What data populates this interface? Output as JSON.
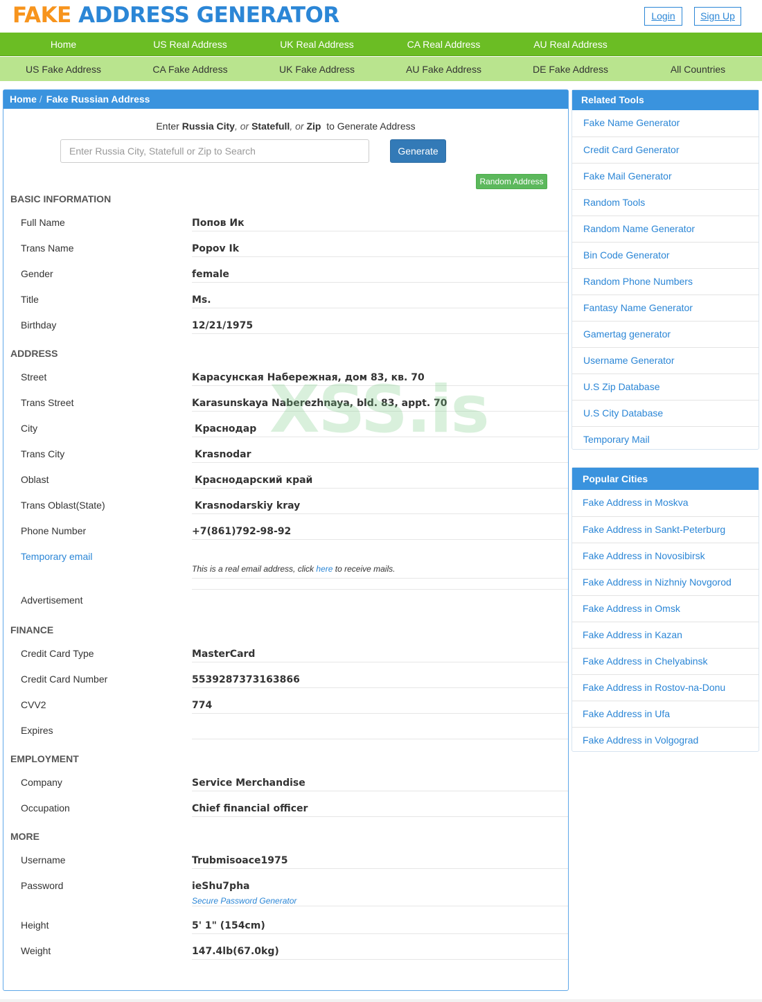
{
  "header": {
    "logo_part1": "FAKE",
    "logo_part2": "ADDRESS GENERATOR",
    "login": "Login",
    "signup": "Sign Up"
  },
  "nav_primary": [
    "Home",
    "US Real Address",
    "UK Real Address",
    "CA Real Address",
    "AU Real Address"
  ],
  "nav_secondary": [
    "US Fake Address",
    "CA Fake Address",
    "UK Fake Address",
    "AU Fake Address",
    "DE Fake Address",
    "All Countries"
  ],
  "breadcrumb": {
    "home": "Home",
    "separator": "/",
    "current": "Fake Russian Address"
  },
  "search": {
    "prefix": "Enter",
    "k1": "Russia City",
    "or1": ", or",
    "k2": "Statefull",
    "or2": ", or",
    "k3": "Zip",
    "suffix": "to Generate Address",
    "placeholder": "Enter Russia City, Statefull or Zip to Search",
    "generate": "Generate",
    "random": "Random Address"
  },
  "watermark": "XSS.is",
  "basic": {
    "title": "BASIC INFORMATION",
    "rows": [
      {
        "label": "Full Name",
        "value": "Попов Ик"
      },
      {
        "label": "Trans Name",
        "value": "Popov Ik"
      },
      {
        "label": "Gender",
        "value": "female"
      },
      {
        "label": "Title",
        "value": "Ms."
      },
      {
        "label": "Birthday",
        "value": "12/21/1975"
      }
    ]
  },
  "address": {
    "title": "ADDRESS",
    "rows": [
      {
        "label": "Street",
        "value": "Карасунская Набережная, дом 83, кв. 70"
      },
      {
        "label": "Trans Street",
        "value": "Karasunskaya Naberezhnaya, bld. 83, appt. 70"
      },
      {
        "label": "City",
        "value": "Краснодар"
      },
      {
        "label": "Trans City",
        "value": "Krasnodar"
      },
      {
        "label": "Oblast",
        "value": "Краснодарский край"
      },
      {
        "label": "Trans Oblast(State)",
        "value": "Krasnodarskiy kray"
      },
      {
        "label": "Phone Number",
        "value": "+7(861)792-98-92"
      }
    ],
    "temp_email_label": "Temporary email",
    "email_note_before": "This is a real email address, click",
    "email_note_link": "here",
    "email_note_after": "to receive mails.",
    "advertisement": "Advertisement"
  },
  "finance": {
    "title": "FINANCE",
    "rows": [
      {
        "label": "Credit Card Type",
        "value": "MasterCard"
      },
      {
        "label": "Credit Card Number",
        "value": "5539287373163866"
      },
      {
        "label": "CVV2",
        "value": "774"
      },
      {
        "label": "Expires",
        "value": ""
      }
    ]
  },
  "employment": {
    "title": "EMPLOYMENT",
    "rows": [
      {
        "label": "Company",
        "value": "Service Merchandise"
      },
      {
        "label": "Occupation",
        "value": "Chief financial officer"
      }
    ]
  },
  "more": {
    "title": "MORE",
    "rows": [
      {
        "label": "Username",
        "value": "Trubmisoace1975"
      },
      {
        "label": "Password",
        "value": "ieShu7pha"
      },
      {
        "label": "Height",
        "value": "5' 1\" (154cm)"
      },
      {
        "label": "Weight",
        "value": "147.4lb(67.0kg)"
      }
    ],
    "password_link": "Secure Password Generator"
  },
  "related_tools": {
    "title": "Related Tools",
    "items": [
      "Fake Name Generator",
      "Credit Card Generator",
      "Fake Mail Generator",
      "Random Tools",
      "Random Name Generator",
      "Bin Code Generator",
      "Random Phone Numbers",
      "Fantasy Name Generator",
      "Gamertag generator",
      "Username Generator",
      "U.S Zip Database",
      "U.S City Database",
      "Temporary Mail"
    ]
  },
  "popular_cities": {
    "title": "Popular Cities",
    "items": [
      "Fake Address in Moskva",
      "Fake Address in Sankt-Peterburg",
      "Fake Address in Novosibirsk",
      "Fake Address in Nizhniy Novgorod",
      "Fake Address in Omsk",
      "Fake Address in Kazan",
      "Fake Address in Chelyabinsk",
      "Fake Address in Rostov-na-Donu",
      "Fake Address in Ufa",
      "Fake Address in Volgograd"
    ]
  },
  "colors": {
    "logo_orange": "#f7941d",
    "logo_blue": "#2b86d6",
    "nav_green": "#6bbd24",
    "nav_light_green": "#b9e48e",
    "panel_blue": "#3a93de",
    "generate_blue": "#337ab7",
    "random_green": "#5cb85c"
  }
}
